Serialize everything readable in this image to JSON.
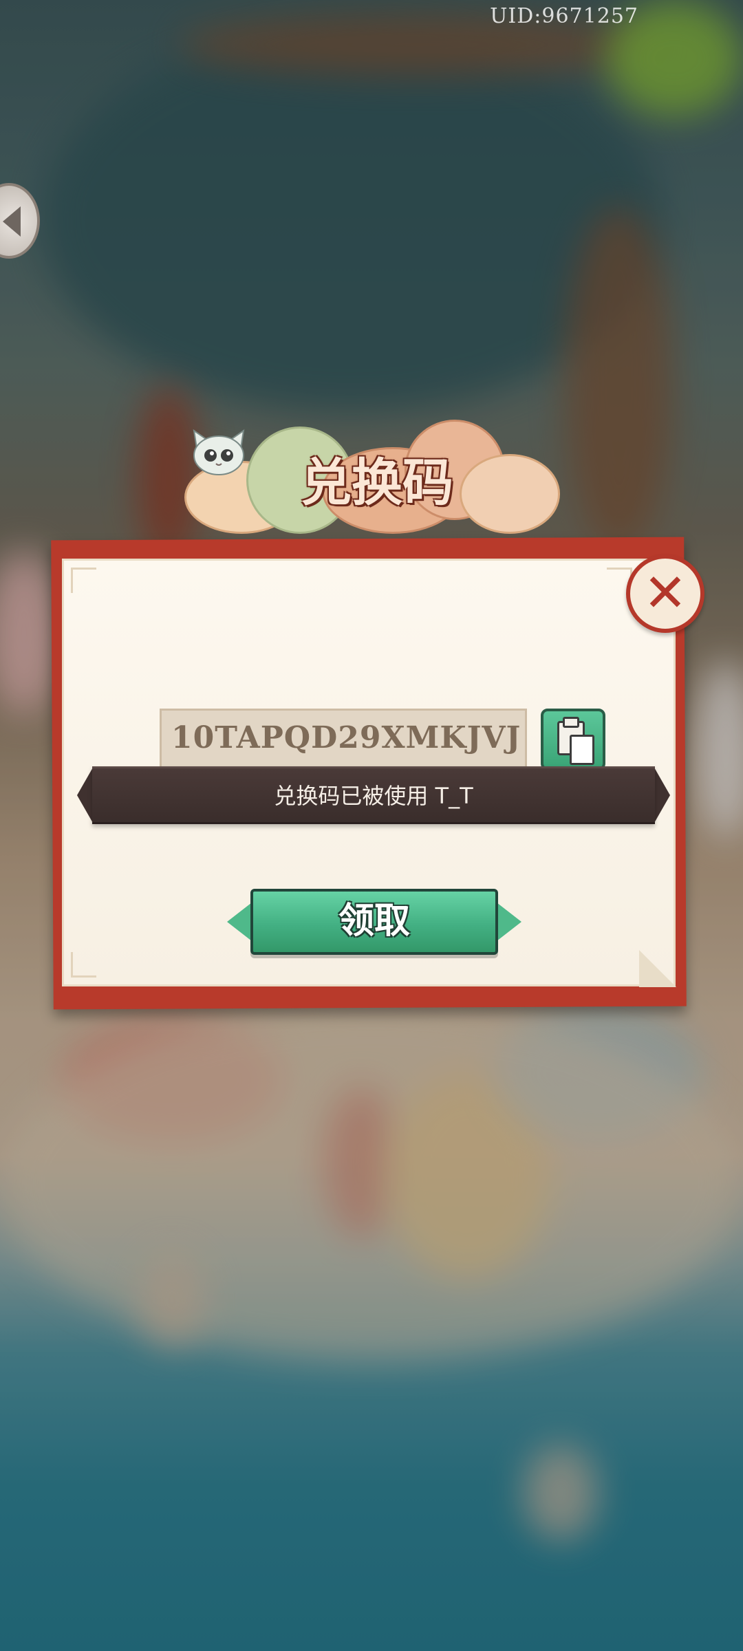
{
  "header": {
    "uid_label": "UID:9671257"
  },
  "dialog": {
    "title": "兑换码",
    "code_value": "10TAPQD29XMKJVJ",
    "toast_message": "兑换码已被使用 T_T",
    "claim_label": "领取"
  },
  "colors": {
    "frame_red": "#b83a2b",
    "paper": "#fdf8ef",
    "button_green": "#43b083",
    "toast_dark": "#3a2d2b",
    "title_text": "#fbe7d6"
  },
  "icons": {
    "back": "back-arrow-icon",
    "close": "close-icon",
    "paste": "clipboard-icon",
    "mascot": "cat-mascot-icon"
  }
}
